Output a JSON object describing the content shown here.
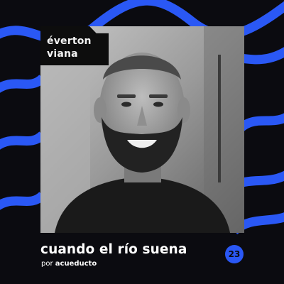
{
  "guest": {
    "first_name": "éverton",
    "last_name": "viana"
  },
  "episode": {
    "title": "cuando el río suena",
    "byline_prefix": "por",
    "byline_brand": "acueducto",
    "number": "23"
  },
  "colors": {
    "background": "#0b0b10",
    "wave": "#2a58f5",
    "badge": "#2a58f5",
    "text": "#ffffff"
  },
  "icons": {
    "photo": "guest-portrait-photo",
    "decoration": "blue-wave-stripes"
  }
}
